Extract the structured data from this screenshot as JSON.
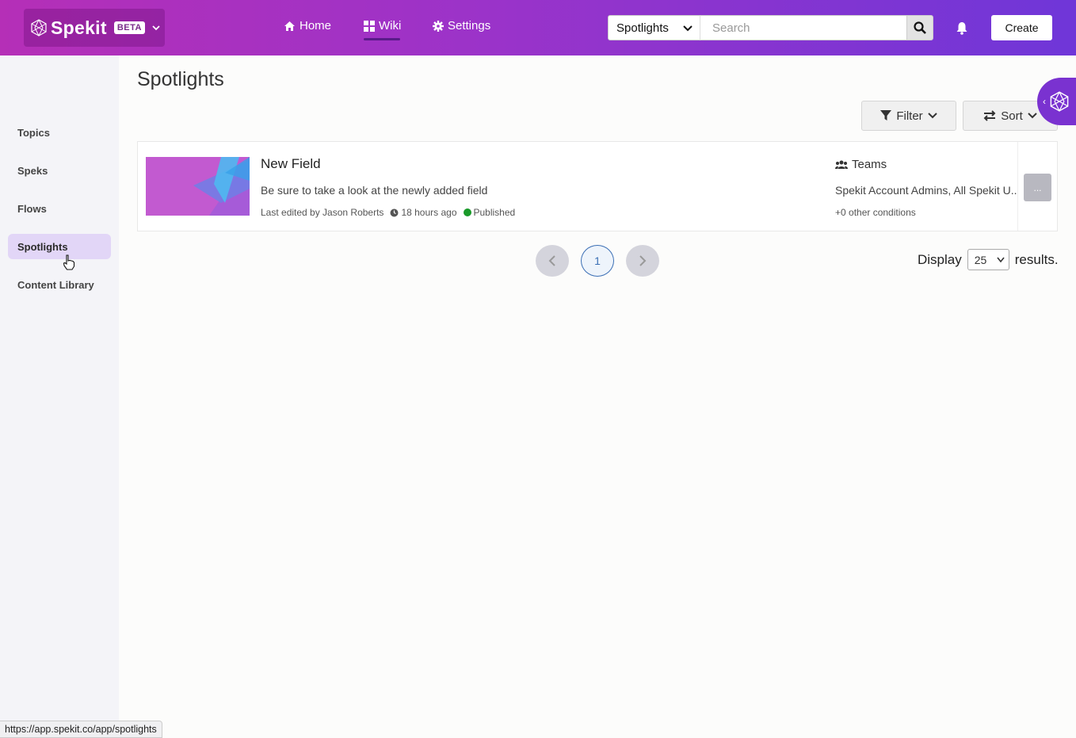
{
  "brand": {
    "name": "Spekit",
    "badge": "BETA"
  },
  "nav": {
    "home": "Home",
    "wiki": "Wiki",
    "settings": "Settings"
  },
  "search": {
    "scope": "Spotlights",
    "placeholder": "Search"
  },
  "header": {
    "create_label": "Create"
  },
  "sidebar": {
    "items": [
      {
        "label": "Topics"
      },
      {
        "label": "Speks"
      },
      {
        "label": "Flows"
      },
      {
        "label": "Spotlights",
        "active": true
      },
      {
        "label": "Content Library"
      }
    ]
  },
  "main": {
    "title": "Spotlights",
    "filter_label": "Filter",
    "sort_label": "Sort",
    "cards": [
      {
        "title": "New Field",
        "description": "Be sure to take a look at the newly added field",
        "edited_by": "Last edited by Jason Roberts",
        "edited_time": "18 hours ago",
        "status": "Published",
        "audience_label": "Teams",
        "audience": "Spekit Account Admins, All Spekit U...",
        "other_conditions": "+0 other conditions",
        "menu": "..."
      }
    ]
  },
  "pagination": {
    "current": "1",
    "display_label": "Display",
    "page_size": "25",
    "results_label": "results."
  },
  "status_bar": {
    "url": "https://app.spekit.co/app/spotlights"
  },
  "colors": {
    "header_start": "#b52fb7",
    "header_end": "#6f36d8",
    "active_nav": "#e2d6f7",
    "published": "#1a9a2a"
  }
}
